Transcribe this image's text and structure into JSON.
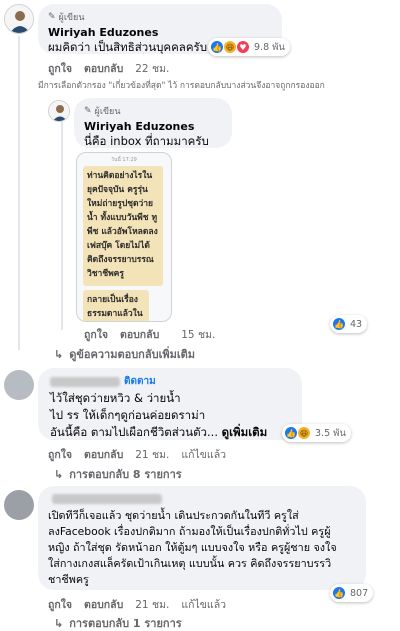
{
  "author_badge": "ผู้เขียน",
  "comment1": {
    "name": "Wiriyah Eduzones",
    "text": "ผมคิดว่า เป็นสิทธิส่วนบุคคลครับ",
    "like": "ถูกใจ",
    "reply": "ตอบกลับ",
    "time": "22 ชม.",
    "reactions": "9.8 พัน",
    "filter_note": "มีการเลือกตัวกรอง \"เกี่ยวข้องที่สุด\" ไว้ การตอบกลับบางส่วนจึงอาจถูกกรองออก"
  },
  "reply1": {
    "name": "Wiriyah Eduzones",
    "text": "นี่คือ inbox ที่ถามมาครับ",
    "phone_time": "วันนี้ 17:29",
    "note1": "ท่านคิดอย่างไรใน\nยุคปัจจุบัน ครูรุ่น\nใหม่ถ่ายรูปชุดว่าย\nน้ำ ทั้งแบบวันพีช ทู\nพีช แล้วอัพโหลดลง\nเฟสบุ๊ค โดยไม่ได้\nคิดถึงจรรยาบรรณ\nวิชาชีพครู",
    "note2": "กลายเป็นเรื่อง\nธรรมดาแล้วใน\nโลกsocial",
    "like": "ถูกใจ",
    "reply": "ตอบกลับ",
    "time": "15 ชม.",
    "reactions": "43"
  },
  "more_replies": "ดูข้อความตอบกลับเพิ่มเติม",
  "comment2": {
    "follow": "ติดตาม",
    "text": "ไว้ใส่ชุดว่ายหวิว & ว่ายน้ำ\nไป รร ให้เด็กๆดูก่อนค่อยดราม่า\nอันนี้คือ ตามไปเผือกชีวิตส่วนตัว...",
    "see_more": "ดูเพิ่มเติม",
    "like": "ถูกใจ",
    "reply": "ตอบกลับ",
    "time": "21 ชม.",
    "edited": "แก้ไขแล้ว",
    "reactions": "3.5 พัน",
    "replies_label": "การตอบกลับ 8 รายการ"
  },
  "comment3": {
    "text": "เปิดทีวีก็เจอแล้ว ชุดว่ายน้ำ เดินประกวดกันในทีวี ครูใส่\nลงFacebook เรื่องปกติมาก ถ้ามองให้เป็นเรื่องปกติทั่วไป ครูผู้\nหญิง ถ้าใส่ชุด รัดหน้าอก ให้ตู้มๆ แบบจงใจ หรือ ครูผู้ชาย จงใจ\nใส่กางเกงสแล็ครัดเป้าเกินเหตุ แบบนั้น ควร คิดถึงจรรยาบรรวิ\nชาชีพครู",
    "like": "ถูกใจ",
    "reply": "ตอบกลับ",
    "time": "21 ชม.",
    "edited": "แก้ไขแล้ว",
    "reactions": "807",
    "replies_label": "การตอบกลับ 1 รายการ"
  },
  "colors": {
    "bubble": "#f0f2f5",
    "like_blue": "#1877f2",
    "love_red": "#f33e58",
    "haha_yellow": "#f7b125",
    "meta_gray": "#65676b",
    "note_yellow": "#f3e3b8"
  },
  "icons": {
    "badge": "pen-icon",
    "reply_arrow": "reply-arrow-icon",
    "like": "thumbs-up-icon",
    "love": "heart-icon",
    "haha": "laugh-icon"
  }
}
